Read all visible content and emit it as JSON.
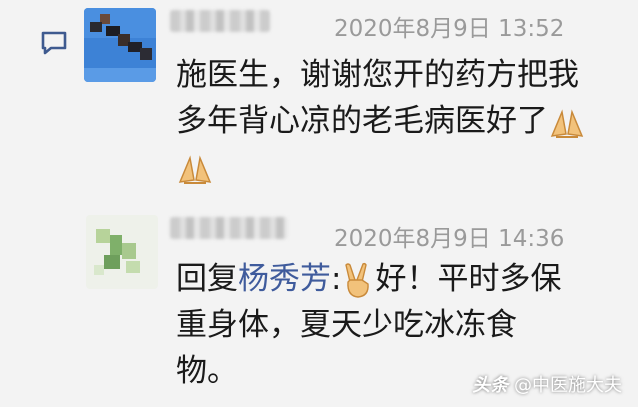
{
  "comments": [
    {
      "timestamp": "2020年8月9日 13:52",
      "text": "施医生，谢谢您开的药方把我多年背心凉的老毛病医好了",
      "emojis": [
        "praying-hands-icon",
        "praying-hands-icon"
      ]
    },
    {
      "timestamp": "2020年8月9日 14:36",
      "reply_prefix": "回复",
      "reply_name": "杨秀芳",
      "reply_colon": ":",
      "emoji": "victory-hand-icon",
      "text": "好！平时多保重身体，夏天少吃冰冻食物。"
    }
  ],
  "watermark": {
    "part1": "头条",
    "part2": "@中医施大夫"
  },
  "colors": {
    "background": "#f3f3f3",
    "timestamp": "#9a9a9a",
    "mention": "#3f5b9c",
    "reply_icon": "#3e5a8f"
  }
}
